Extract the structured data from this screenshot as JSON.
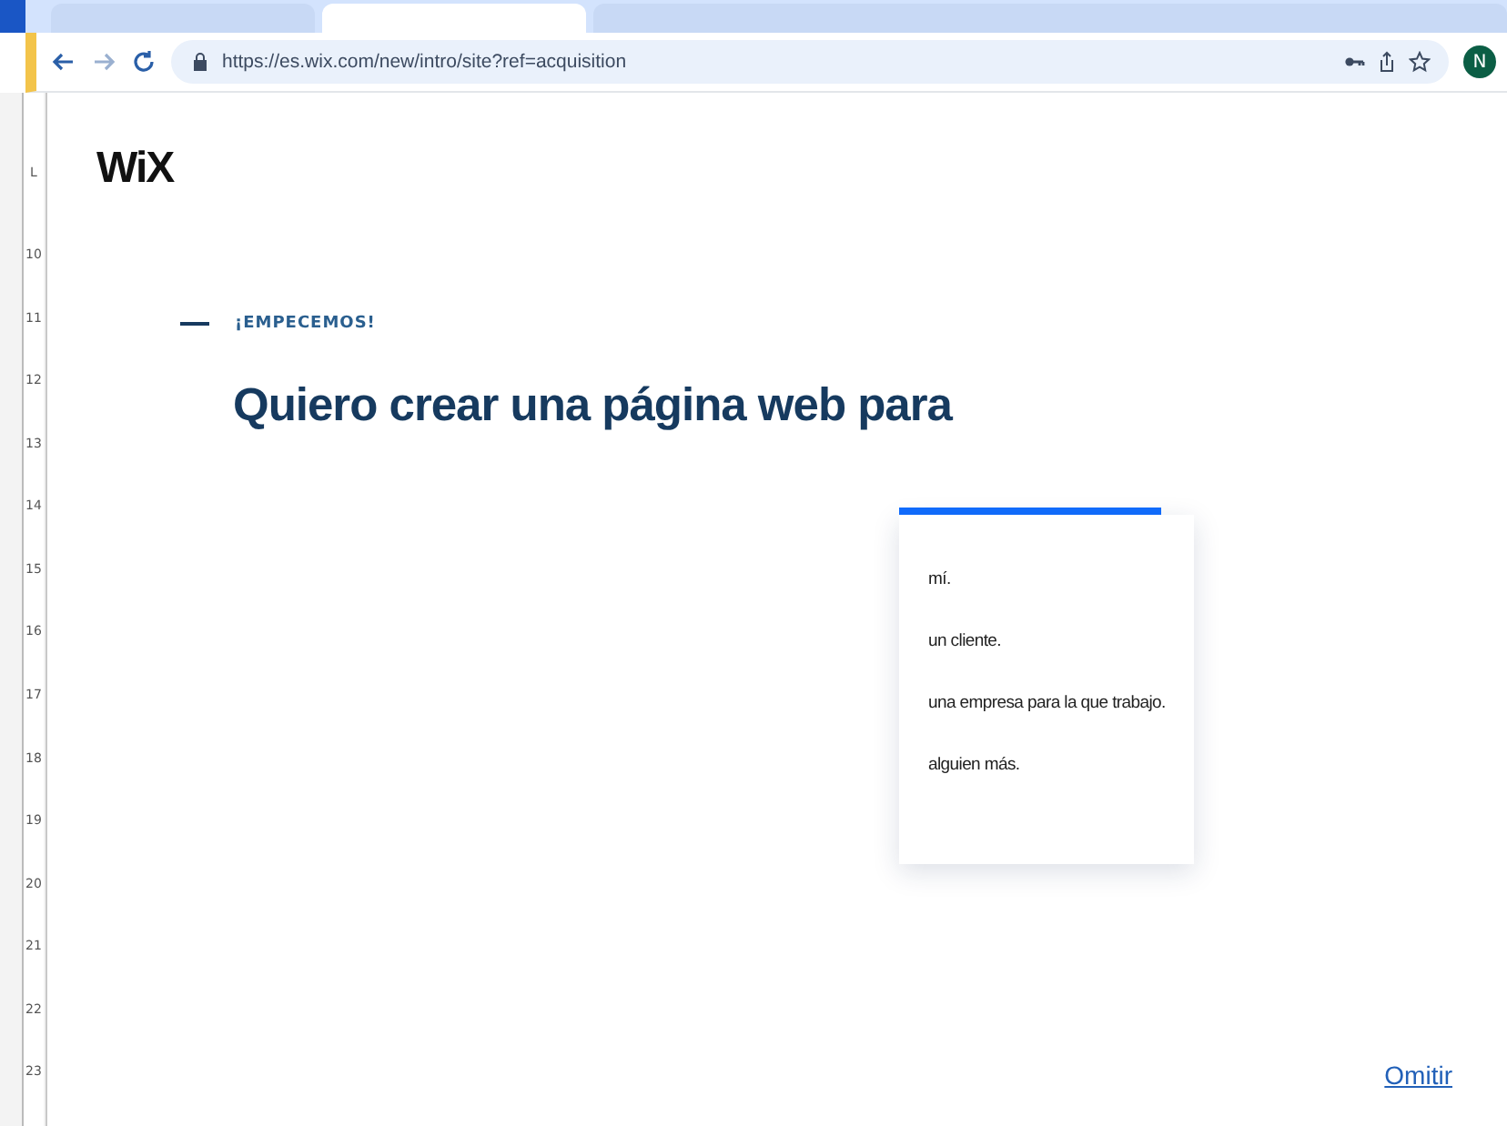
{
  "tabs": [
    {
      "selected": false
    },
    {
      "selected": true
    },
    {
      "selected": false
    }
  ],
  "browser": {
    "url": "https://es.wix.com/new/intro/site?ref=acquisition",
    "profile_initial": "N"
  },
  "ruler": {
    "corner": "L",
    "numbers": [
      "10",
      "11",
      "12",
      "13",
      "14",
      "15",
      "16",
      "17",
      "18",
      "19",
      "20",
      "21",
      "22",
      "23"
    ]
  },
  "page": {
    "logo": "WiX",
    "eyebrow": "¡EMPECEMOS!",
    "heading": "Quiero crear una página web para",
    "options": [
      "mí.",
      "un cliente.",
      "una empresa para la que trabajo.",
      "alguien más."
    ],
    "skip_link": "Omitir"
  }
}
